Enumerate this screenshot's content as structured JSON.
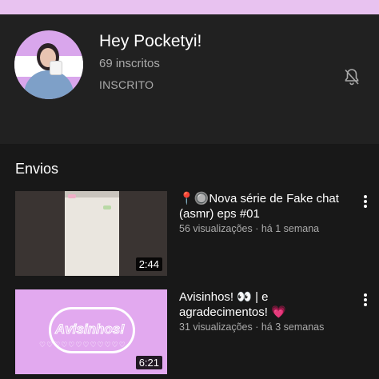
{
  "channel": {
    "name": "Hey Pocketyi!",
    "subscribers": "69 inscritos",
    "subscribe_state": "INSCRITO"
  },
  "uploads": {
    "title": "Envios",
    "videos": [
      {
        "title": "📍🔘Nova série de Fake chat (asmr) eps #01",
        "meta": "56 visualizações · há 1 semana",
        "duration": "2:44"
      },
      {
        "title": "Avisinhos! 👀 | e agradecimentos! 💗",
        "meta": "31 visualizações · há 3 semanas",
        "duration": "6:21",
        "thumb_text": "Avisinhos!",
        "thumb_hearts": "♡♡♡♡♡♡♡♡♡♡♡♡"
      }
    ]
  },
  "icons": {
    "bell": "bell-off-icon",
    "more": "more-vert-icon"
  },
  "colors": {
    "background": "#181818",
    "header": "#212121",
    "accent": "#e8c2f0",
    "secondary_text": "#aaaaaa"
  }
}
